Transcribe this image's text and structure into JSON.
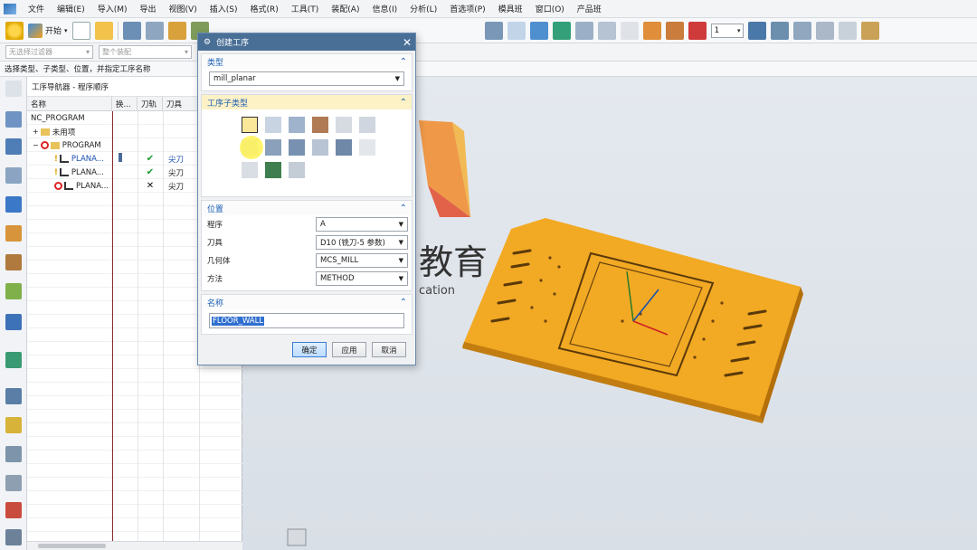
{
  "menu": [
    "文件",
    "编辑(E)",
    "导入(M)",
    "导出",
    "视图(V)",
    "插入(S)",
    "格式(R)",
    "工具(T)",
    "装配(A)",
    "信息(I)",
    "分析(L)",
    "首选项(P)",
    "模具班",
    "窗口(O)",
    "产品班"
  ],
  "toolbar": {
    "start_label": "开始",
    "layer_value": "1"
  },
  "filter": {
    "type_filter": "无选择过滤器",
    "scope_filter": "整个装配"
  },
  "cue_line": "选择类型、子类型、位置，并指定工序名称",
  "navigator": {
    "title": "工序导航器 - 程序顺序",
    "columns": {
      "name": "名称",
      "toolchange": "换...",
      "path": "刀轨",
      "tool": "刀具"
    },
    "rows": [
      {
        "name": "NC_PROGRAM",
        "path": "",
        "tool": ""
      },
      {
        "name": "未用项",
        "path": "",
        "tool": ""
      },
      {
        "name": "PROGRAM",
        "path": "",
        "tool": ""
      },
      {
        "name": "PLANA...",
        "path": "✔",
        "tool": "尖刀"
      },
      {
        "name": "PLANA...",
        "path": "✔",
        "tool": "尖刀"
      },
      {
        "name": "PLANA...",
        "path": "✕",
        "tool": "尖刀"
      }
    ]
  },
  "graphics": {
    "logo_chars": "教育",
    "logo_sub": "cation"
  },
  "dialog": {
    "title": "创建工序",
    "type_section": "类型",
    "type_value": "mill_planar",
    "subtype_section": "工序子类型",
    "location_section": "位置",
    "program_label": "程序",
    "program_value": "A",
    "tool_label": "刀具",
    "tool_value": "D10 (铣刀-5 参数)",
    "geometry_label": "几何体",
    "geometry_value": "MCS_MILL",
    "method_label": "方法",
    "method_value": "METHOD",
    "name_section": "名称",
    "name_value": "FLOOR_WALL",
    "ok": "确定",
    "apply": "应用",
    "cancel": "取消"
  }
}
